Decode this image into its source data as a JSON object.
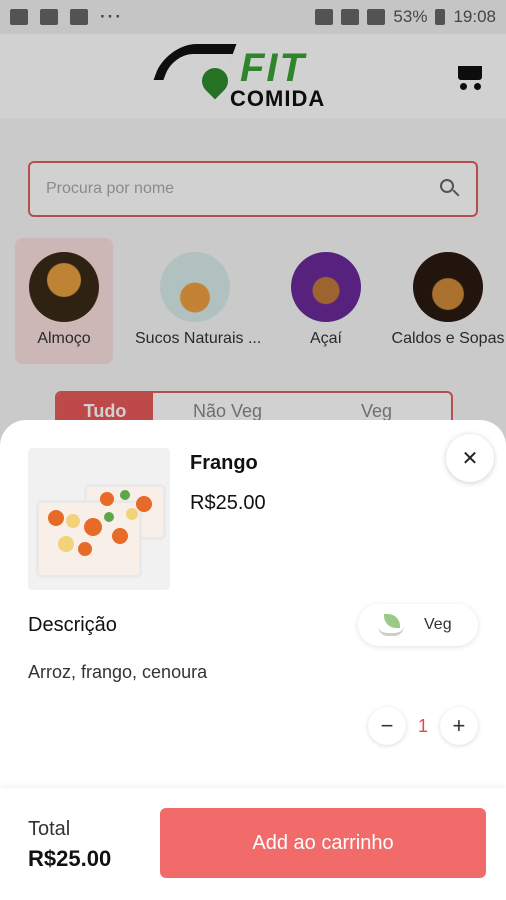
{
  "status_bar": {
    "battery": "53%",
    "time": "19:08",
    "dots": "···"
  },
  "header": {
    "logo_fit": "FIT",
    "logo_comida": "COMIDA"
  },
  "search": {
    "placeholder": "Procura por nome"
  },
  "categories": [
    {
      "label": "Almoço"
    },
    {
      "label": "Sucos Naturais ..."
    },
    {
      "label": "Açaí"
    },
    {
      "label": "Caldos e Sopas"
    }
  ],
  "filters": [
    {
      "label": "Tudo"
    },
    {
      "label": "Não Veg"
    },
    {
      "label": "Veg"
    }
  ],
  "product": {
    "name": "Frango",
    "price": "R$25.00",
    "description_title": "Descrição",
    "description": "Arroz, frango, cenoura",
    "veg_label": "Veg",
    "quantity": "1",
    "decrement": "−",
    "increment": "+",
    "close": "✕"
  },
  "footer": {
    "total_label": "Total",
    "total_value": "R$25.00",
    "add_button": "Add ao carrinho"
  },
  "colors": {
    "accent": "#f26b6b",
    "brand_green": "#3aa335"
  }
}
